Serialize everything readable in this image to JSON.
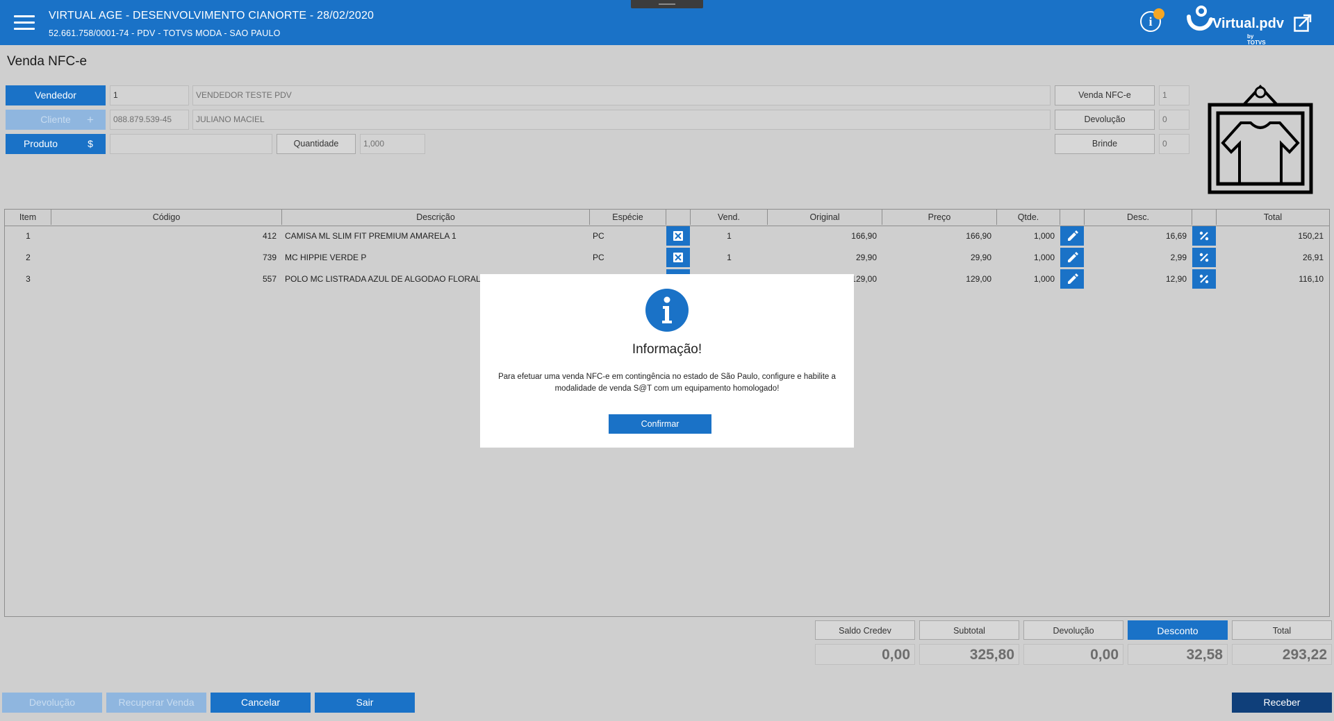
{
  "header": {
    "title": "VIRTUAL AGE - DESENVOLVIMENTO CIANORTE - 28/02/2020",
    "subtitle": "52.661.758/0001-74 - PDV - TOTVS MODA - SAO PAULO",
    "brand_name": "Virtual.pdv",
    "brand_sub": "by TOTVS",
    "accent": "#1a72c7",
    "notification_color": "#f5a623"
  },
  "page": {
    "title": "Venda NFC-e"
  },
  "form": {
    "vendedor_label": "Vendedor",
    "vendedor_code": "1",
    "vendedor_name": "VENDEDOR TESTE PDV",
    "cliente_label": "Cliente",
    "cliente_add": "+",
    "cliente_doc": "088.879.539-45",
    "cliente_name": "JULIANO MACIEL",
    "produto_label": "Produto",
    "price_label": "$",
    "produto_value": "",
    "quantidade_label": "Quantidade",
    "quantidade_value": "1,000"
  },
  "counters": [
    {
      "label": "Venda NFC-e",
      "value": "1"
    },
    {
      "label": "Devolução",
      "value": "0"
    },
    {
      "label": "Brinde",
      "value": "0"
    }
  ],
  "table": {
    "headers": [
      "Item",
      "Código",
      "Descrição",
      "Espécie",
      "",
      "Vend.",
      "Original",
      "Preço",
      "Qtde.",
      "",
      "Desc.",
      "",
      "Total"
    ],
    "rows": [
      {
        "item": "1",
        "codigo": "412",
        "descricao": "CAMISA ML SLIM FIT PREMIUM AMARELA 1",
        "especie": "PC",
        "vend": "1",
        "original": "166,90",
        "preco": "166,90",
        "qtde": "1,000",
        "desc": "16,69",
        "total": "150,21"
      },
      {
        "item": "2",
        "codigo": "739",
        "descricao": "MC HIPPIE VERDE P",
        "especie": "PC",
        "vend": "1",
        "original": "29,90",
        "preco": "29,90",
        "qtde": "1,000",
        "desc": "2,99",
        "total": "26,91"
      },
      {
        "item": "3",
        "codigo": "557",
        "descricao": "POLO MC LISTRADA AZUL DE ALGODAO FLORAL 2",
        "especie": "",
        "vend": "",
        "original": "129,00",
        "preco": "129,00",
        "qtde": "1,000",
        "desc": "12,90",
        "total": "116,10"
      }
    ]
  },
  "totals": {
    "saldo_label": "Saldo Credev",
    "saldo": "0,00",
    "subtotal_label": "Subtotal",
    "subtotal": "325,80",
    "devolucao_label": "Devolução",
    "devolucao": "0,00",
    "desconto_label": "Desconto",
    "desconto": "32,58",
    "total_label": "Total",
    "total": "293,22"
  },
  "footer": {
    "devolucao": "Devolução",
    "recuperar": "Recuperar Venda",
    "cancelar": "Cancelar",
    "sair": "Sair",
    "receber": "Receber"
  },
  "modal": {
    "title": "Informação!",
    "message": "Para efetuar uma venda NFC-e em contingência no estado de São Paulo, configure e habilite a modalidade de venda S@T com um equipamento homologado!",
    "confirm": "Confirmar"
  }
}
